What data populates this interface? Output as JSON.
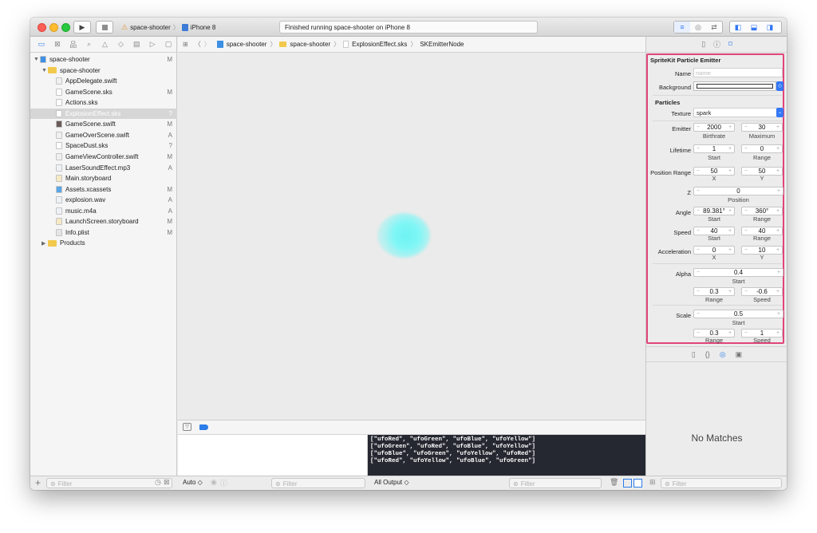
{
  "toolbar": {
    "scheme": "space-shooter",
    "device": "iPhone 8",
    "activity": "Finished running space-shooter on iPhone 8",
    "run_icon": "play-icon",
    "stop_icon": "stop-icon"
  },
  "navigator": {
    "items": [
      {
        "label": "space-shooter",
        "status": "M",
        "kind": "project"
      },
      {
        "label": "space-shooter",
        "status": "",
        "kind": "folder"
      },
      {
        "label": "AppDelegate.swift",
        "status": "",
        "kind": "swift"
      },
      {
        "label": "GameScene.sks",
        "status": "M",
        "kind": "sks"
      },
      {
        "label": "Actions.sks",
        "status": "",
        "kind": "sks"
      },
      {
        "label": "ExplosionEffect.sks",
        "status": "?",
        "kind": "sks"
      },
      {
        "label": "GameScene.swift",
        "status": "M",
        "kind": "swift-dark"
      },
      {
        "label": "GameOverScene.swift",
        "status": "A",
        "kind": "swift"
      },
      {
        "label": "SpaceDust.sks",
        "status": "?",
        "kind": "sks"
      },
      {
        "label": "GameViewController.swift",
        "status": "M",
        "kind": "swift"
      },
      {
        "label": "LaserSoundEffect.mp3",
        "status": "A",
        "kind": "audio"
      },
      {
        "label": "Main.storyboard",
        "status": "",
        "kind": "storyboard"
      },
      {
        "label": "Assets.xcassets",
        "status": "M",
        "kind": "assets"
      },
      {
        "label": "explosion.wav",
        "status": "A",
        "kind": "audio"
      },
      {
        "label": "music.m4a",
        "status": "A",
        "kind": "audio"
      },
      {
        "label": "LaunchScreen.storyboard",
        "status": "M",
        "kind": "storyboard"
      },
      {
        "label": "Info.plist",
        "status": "M",
        "kind": "plist"
      },
      {
        "label": "Products",
        "status": "",
        "kind": "folder"
      }
    ],
    "filter_placeholder": "Filter"
  },
  "jumpbar": [
    "space-shooter",
    "space-shooter",
    "ExplosionEffect.sks",
    "SKEmitterNode"
  ],
  "console": {
    "lines": [
      "[\"ufoRed\", \"ufoGreen\", \"ufoBlue\", \"ufoYellow\"]",
      "[\"ufoGreen\", \"ufoRed\", \"ufoBlue\", \"ufoYellow\"]",
      "[\"ufoBlue\", \"ufoGreen\", \"ufoYellow\", \"ufoRed\"]",
      "[\"ufoRed\", \"ufoYellow\", \"ufoBlue\", \"ufoGreen\"]"
    ],
    "auto_label": "Auto ◇",
    "output_label": "All Output ◇",
    "filter_placeholder": "Filter"
  },
  "inspector": {
    "title": "SpriteKit Particle Emitter",
    "name_label": "Name",
    "name_placeholder": "name",
    "background_label": "Background",
    "particles_header": "Particles",
    "texture_label": "Texture",
    "texture_value": "spark",
    "emitter_label": "Emitter",
    "birthrate": "2000",
    "birthrate_label": "Birthrate",
    "maximum": "30",
    "maximum_label": "Maximum",
    "lifetime_label": "Lifetime",
    "lifetime_start": "1",
    "lifetime_range": "0",
    "start_label": "Start",
    "range_label": "Range",
    "position_range_label": "Position Range",
    "pos_x": "50",
    "pos_y": "50",
    "x_label": "X",
    "y_label": "Y",
    "z_label": "Z",
    "z_value": "0",
    "position_label": "Position",
    "angle_label": "Angle",
    "angle_start": "89.381°",
    "angle_range": "360°",
    "speed_label": "Speed",
    "speed_start": "40",
    "speed_range": "40",
    "acceleration_label": "Acceleration",
    "accel_x": "0",
    "accel_y": "10",
    "alpha_label": "Alpha",
    "alpha_start": "0.4",
    "alpha_range": "0.3",
    "alpha_speed": "-0.6",
    "speed_sub_label": "Speed",
    "scale_label": "Scale",
    "scale_start": "0.5",
    "scale_range": "0.3",
    "scale_speed": "1",
    "no_matches": "No Matches",
    "library_filter_placeholder": "Filter"
  },
  "colors": {
    "highlight": "#e0457b",
    "accent": "#2b7de9",
    "particle": "#6ff3f3",
    "console_bg": "#252830"
  }
}
